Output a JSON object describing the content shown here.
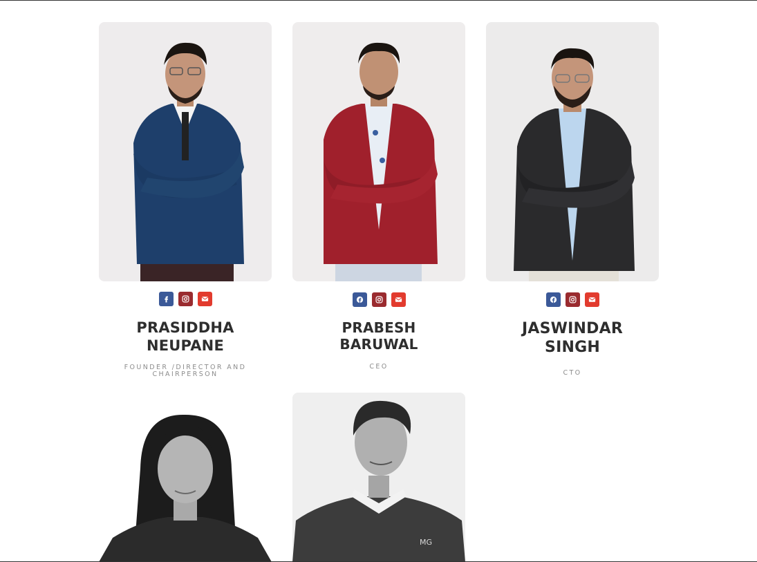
{
  "team": [
    {
      "name": "PRASIDDHA NEUPANE",
      "name_line1": "PRASIDDHA",
      "name_line2": "NEUPANE",
      "role": "FOUNDER /DIRECTOR AND CHAIRPERSON",
      "photo": "portrait-blue-blazer",
      "socials": [
        "facebook-icon",
        "instagram-icon",
        "email-icon"
      ]
    },
    {
      "name": "PRABESH BARUWAL",
      "name_line1": "PRABESH",
      "name_line2": "BARUWAL",
      "role": "CEO",
      "photo": "portrait-red-blazer",
      "socials": [
        "facebook-icon",
        "instagram-icon",
        "email-icon"
      ]
    },
    {
      "name": "JASWINDAR SINGH",
      "name_line1": "JASWINDAR",
      "name_line2": "SINGH",
      "role": "CTO",
      "photo": "portrait-black-blazer",
      "socials": [
        "facebook-icon",
        "instagram-icon",
        "email-icon"
      ]
    },
    {
      "photo": "portrait-woman-grayscale"
    },
    {
      "photo": "portrait-man-grayscale-sweater"
    }
  ],
  "colors": {
    "facebook": "#3b5998",
    "instagram": "#9a2b2f",
    "email": "#e23b2e",
    "name_text": "#2e2e2e",
    "role_text": "#8c8c8c"
  }
}
